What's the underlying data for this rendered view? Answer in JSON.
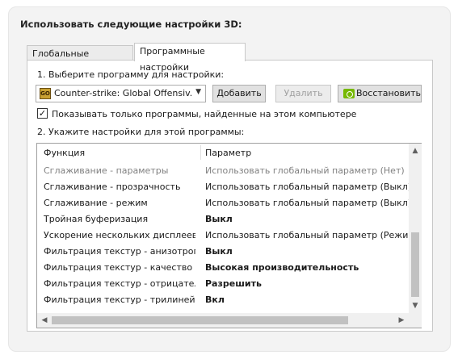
{
  "heading": "Использовать следующие настройки 3D:",
  "tabs": [
    {
      "label": "Глобальные параметры",
      "active": false
    },
    {
      "label": "Программные настройки",
      "active": true
    }
  ],
  "step1": {
    "label": "1. Выберите программу для настройки:",
    "program_value": "Counter-strike: Global Offensiv...",
    "program_icon_text": "GO",
    "add_button": "Добавить",
    "remove_button": "Удалить",
    "restore_button": "Восстановить"
  },
  "checkbox": {
    "label": "Показывать только программы, найденные на этом компьютере",
    "checked": true
  },
  "step2": {
    "label": "2. Укажите настройки для этой программы:",
    "columns": [
      "Функция",
      "Параметр"
    ],
    "rows": [
      {
        "feature": "Сглаживание - параметры",
        "value": "Использовать глобальный параметр (Нет)",
        "dim": true,
        "bold": false
      },
      {
        "feature": "Сглаживание - прозрачность",
        "value": "Использовать глобальный параметр (Выкл)",
        "dim": false,
        "bold": false
      },
      {
        "feature": "Сглаживание - режим",
        "value": "Использовать глобальный параметр (Выкл)",
        "dim": false,
        "bold": false
      },
      {
        "feature": "Тройная буферизация",
        "value": "Выкл",
        "dim": false,
        "bold": true
      },
      {
        "feature": "Ускорение нескольких дисплеев/...",
        "value": "Использовать глобальный параметр (Режим многомониторной производительности)",
        "dim": false,
        "bold": false
      },
      {
        "feature": "Фильтрация текстур - анизотропн...",
        "value": "Выкл",
        "dim": false,
        "bold": true
      },
      {
        "feature": "Фильтрация текстур - качество",
        "value": "Высокая производительность",
        "dim": false,
        "bold": true
      },
      {
        "feature": "Фильтрация текстур - отрицател...",
        "value": "Разрешить",
        "dim": false,
        "bold": true
      },
      {
        "feature": "Фильтрация текстур - трилинейн...",
        "value": "Вкл",
        "dim": false,
        "bold": true
      }
    ]
  },
  "colors": {
    "nvidia_green": "#76b900",
    "disabled_text": "#a0a0a0",
    "dim_row_text": "#808080"
  }
}
